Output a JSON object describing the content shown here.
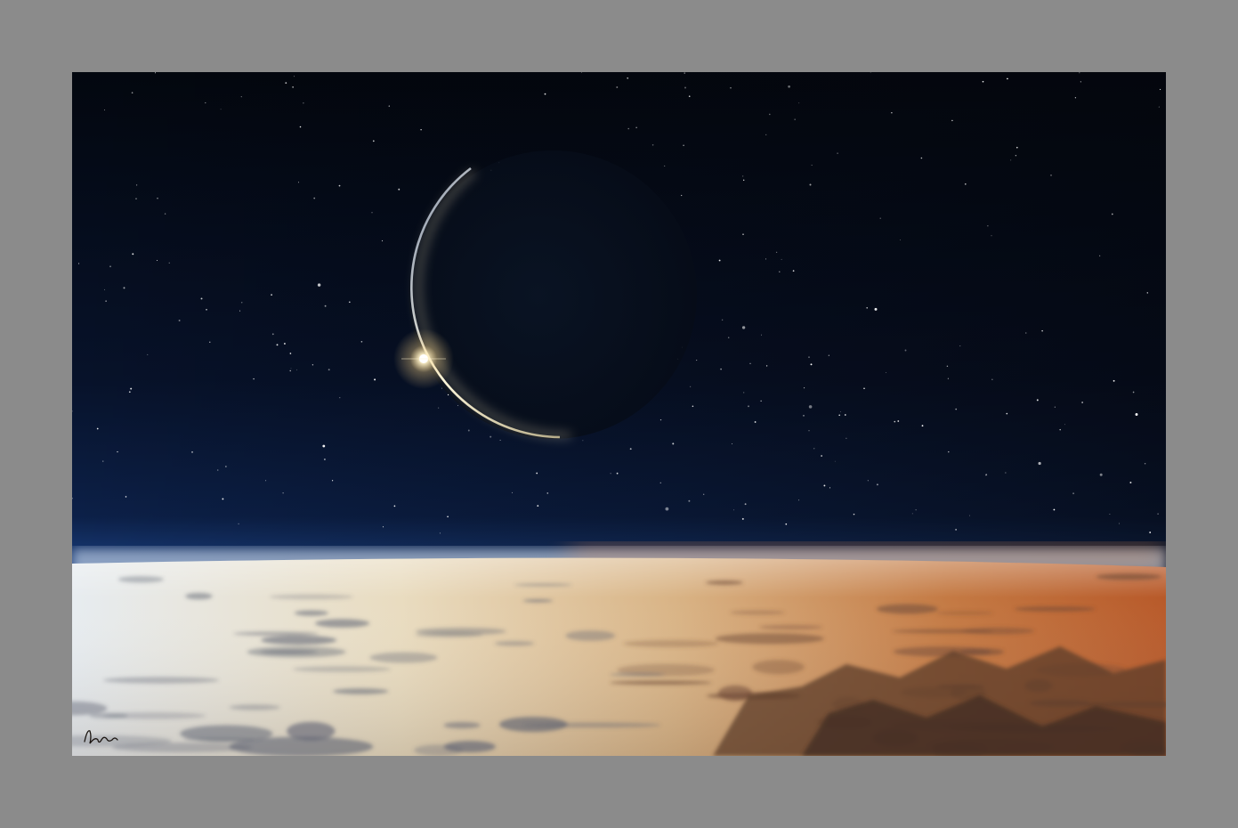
{
  "scene": {
    "subject": "eclipse-over-planet-horizon",
    "colors": {
      "frame": "#8b8b8b",
      "space_top": "#040810",
      "space_mid": "#0b1a35",
      "horizon_blue": "#2b5fb0",
      "horizon_glow": "#cfe6ff",
      "clouds_light": "#e9d4a8",
      "clouds_shadow": "#5a5660",
      "terrain_orange": "#c0602a",
      "terrain_dark": "#4a3328",
      "eclipse_rim": "#fff6d8",
      "sun_flare": "#ffe9b0"
    },
    "icons": {
      "signature": "signature-mark"
    }
  }
}
